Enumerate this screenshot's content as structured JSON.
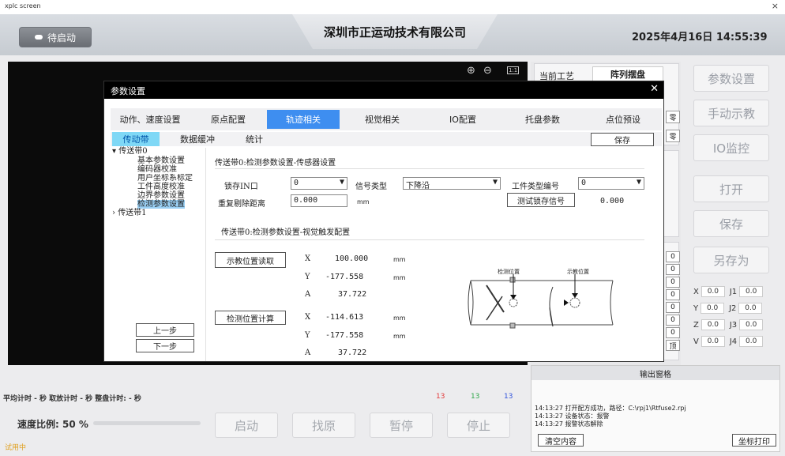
{
  "window": {
    "title": "xplc screen",
    "close": "×"
  },
  "header": {
    "status_label": "待启动",
    "company": "深圳市正运动技术有限公司",
    "datetime": "2025年4月16日  14:55:39"
  },
  "canvas_toolbar": {
    "zoom_in": "⊕",
    "zoom_out": "⊖",
    "fit": "1:1"
  },
  "info": {
    "current_process_label": "当前工艺",
    "current_process_value": "阵列摆盘",
    "zero1": "零",
    "zero2": "零",
    "rpanel_small": [
      "0",
      "0",
      "0",
      "0",
      "0",
      "0",
      "0",
      "0"
    ],
    "end_label": "顶"
  },
  "right_buttons": [
    "参数设置",
    "手动示教",
    "IO监控",
    "打开",
    "保存",
    "另存为"
  ],
  "coords": {
    "labels": [
      "X",
      "Y",
      "Z",
      "V"
    ],
    "values": [
      "0.0",
      "0.0",
      "0.0",
      "0.0"
    ],
    "jlabels": [
      "J1",
      "J2",
      "J3",
      "J4"
    ],
    "jvalues": [
      "0.0",
      "0.0",
      "0.0",
      "0.0"
    ]
  },
  "dialog": {
    "title": "参数设置",
    "close": "✕",
    "tabs": [
      "动作、速度设置",
      "原点配置",
      "轨迹相关",
      "视觉相关",
      "IO配置",
      "托盘参数",
      "点位预设"
    ],
    "active_tab": "轨迹相关",
    "subtabs": [
      "传动带",
      "数据缓冲",
      "统计"
    ],
    "save": "保存",
    "tree": {
      "conveyor0": "传送带0",
      "items": [
        "基本参数设置",
        "编码器校准",
        "用户坐标系标定",
        "工件高度校准",
        "边界参数设置",
        "检测参数设置"
      ],
      "conveyor1": "传送带1"
    },
    "prev": "上一步",
    "next": "下一步",
    "section1": "传送带0:检测参数设置-传感器设置",
    "latch_label": "锁存IN口",
    "latch_value": "0",
    "signal_label": "信号类型",
    "signal_value": "下降沿",
    "worktype_label": "工件类型编号",
    "worktype_value": "0",
    "reject_label": "重复剔除距离",
    "reject_value": "0.000",
    "reject_unit": "mm",
    "test_latch": "测试锁存信号",
    "test_value": "0.000",
    "section2": "传送带0:检测参数设置-视觉触发配置",
    "teach_read": "示教位置读取",
    "teach": {
      "X": "100.000",
      "Y": "-177.558",
      "A": "37.722"
    },
    "detect_calc": "检测位置计算",
    "detect": {
      "X": "-114.613",
      "Y": "-177.558",
      "A": "37.722"
    },
    "unit": "mm",
    "diagram": {
      "detect_pos": "检测位置",
      "teach_pos": "示教位置"
    }
  },
  "bottom": {
    "timers": "平均计时  -  秒  取放计时  -  秒  整盘计时:  -  秒",
    "counts": [
      "13",
      "13",
      "13"
    ],
    "speed_label": "速度比例: 50 %",
    "trial": "试用中",
    "controls": [
      "启动",
      "找原",
      "暂停",
      "停止"
    ]
  },
  "output": {
    "title": "输出窗格",
    "lines": [
      "14:13:27 打开配方成功，路径：C:\\rpj1\\Rtfuse2.rpj",
      "14:13:27 设备状态：报警",
      "14:13:27 报警状态解除"
    ],
    "clear": "清空内容",
    "print": "坐标打印"
  }
}
